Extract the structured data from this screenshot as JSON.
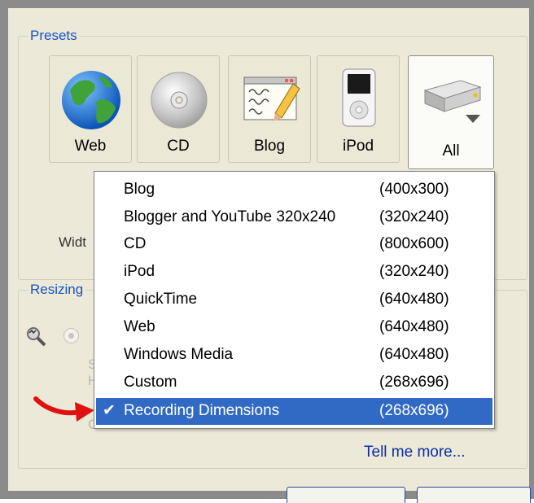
{
  "presets": {
    "group_label": "Presets",
    "buttons": [
      {
        "label": "Web",
        "icon": "globe-icon"
      },
      {
        "label": "CD",
        "icon": "cd-icon"
      },
      {
        "label": "Blog",
        "icon": "blog-icon"
      },
      {
        "label": "iPod",
        "icon": "ipod-icon"
      },
      {
        "label": "All",
        "icon": "device-dropdown-icon"
      }
    ]
  },
  "width_label": "Widt",
  "resizing_label": "Resizing",
  "menu": {
    "items": [
      {
        "name": "Blog",
        "dims": "(400x300)"
      },
      {
        "name": "Blogger and YouTube 320x240",
        "dims": "(320x240)"
      },
      {
        "name": "CD",
        "dims": "(800x600)"
      },
      {
        "name": "iPod",
        "dims": "(320x240)"
      },
      {
        "name": "QuickTime",
        "dims": "(640x480)"
      },
      {
        "name": "Web",
        "dims": "(640x480)"
      },
      {
        "name": "Windows Media",
        "dims": "(640x480)"
      },
      {
        "name": "Custom",
        "dims": "(268x696)"
      },
      {
        "name": "Recording Dimensions",
        "dims": "(268x696)",
        "selected": true
      }
    ]
  },
  "tell_me_more": "Tell me more...",
  "colors": {
    "selection": "#316ac5",
    "arrow": "#e01010",
    "link": "#0b2ea8"
  }
}
